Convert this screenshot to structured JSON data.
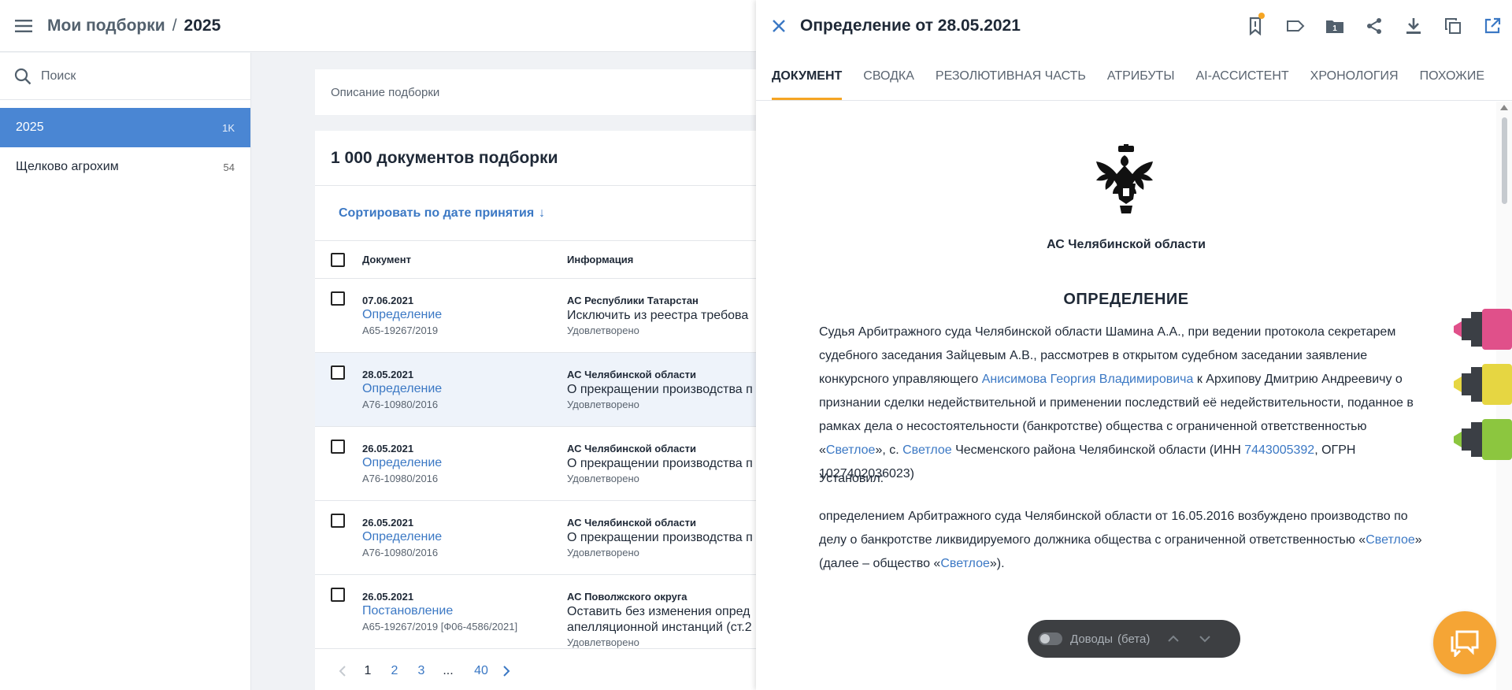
{
  "header": {
    "menu_icon": "hamburger-icon",
    "crumb_root": "Мои подборки",
    "crumb_sep": "/",
    "crumb_current": "2025"
  },
  "sidebar": {
    "search_placeholder": "Поиск",
    "items": [
      {
        "label": "2025",
        "count": "1K",
        "active": true
      },
      {
        "label": "Щелково агрохим",
        "count": "54",
        "active": false
      }
    ]
  },
  "main": {
    "description_placeholder": "Описание подборки",
    "list_title": "1 000 документов подборки",
    "sort_label": "Сортировать по дате принятия",
    "sort_arrow": "↓",
    "col_document": "Документ",
    "col_info": "Информация",
    "rows": [
      {
        "date": "07.06.2021",
        "type": "Определение",
        "num": "А65-19267/2019",
        "court": "АС Республики Татарстан",
        "text": "Исключить из реестра требова",
        "status": "Удовлетворено"
      },
      {
        "date": "28.05.2021",
        "type": "Определение",
        "num": "А76-10980/2016",
        "court": "АС Челябинской области",
        "text": "О прекращении производства п",
        "status": "Удовлетворено"
      },
      {
        "date": "26.05.2021",
        "type": "Определение",
        "num": "А76-10980/2016",
        "court": "АС Челябинской области",
        "text": "О прекращении производства п",
        "status": "Удовлетворено"
      },
      {
        "date": "26.05.2021",
        "type": "Определение",
        "num": "А76-10980/2016",
        "court": "АС Челябинской области",
        "text": "О прекращении производства п",
        "status": "Удовлетворено"
      },
      {
        "date": "26.05.2021",
        "type": "Постановление",
        "num": "А65-19267/2019 [Ф06-4586/2021]",
        "court": "АС Поволжского округа",
        "text": "Оставить без изменения опред",
        "text2": "апелляционной инстанций (ст.2",
        "status": "Удовлетворено"
      }
    ],
    "pager": {
      "pages": [
        "1",
        "2",
        "3"
      ],
      "dots": "...",
      "last": "40",
      "current": "1"
    }
  },
  "panel": {
    "title": "Определение от 28.05.2021",
    "tools": [
      "bookmark-icon",
      "tag-icon",
      "folder-icon",
      "share-icon",
      "download-icon",
      "copy-icon",
      "open-external-icon"
    ],
    "folder_badge": "1",
    "tabs": [
      "Документ",
      "Сводка",
      "Резолютивная часть",
      "Атрибуты",
      "AI-Ассистент",
      "Хронология",
      "Похожие"
    ],
    "active_tab": 0,
    "doc": {
      "court": "АС Челябинской области",
      "title": "ОПРЕДЕЛЕНИЕ",
      "p1_a": "Судья Арбитражного суда Челябинской области Шамина А.А., при ведении протокола секретарем судебного заседания Зайцевым А.В., рассмотрев в открытом судебном заседании заявление конкурсного управляющего ",
      "p1_link1": "Анисимова Георгия Владимировича",
      "p1_b": " к Архипову Дмитрию Андреевичу о признании сделки недействительной и применении последствий её недействительности, поданное в рамках дела о несостоятельности (банкротстве) общества с ограниченной ответственностью «",
      "p1_link2": "Светлое",
      "p1_c": "», с. ",
      "p1_link3": "Светлое",
      "p1_d": " Чесменского района Челябинской области (ИНН ",
      "p1_link4": "7443005392",
      "p1_e": ", ОГРН 1027402036023)",
      "p2": "Установил:",
      "p3_a": "определением Арбитражного суда Челябинской области от 16.05.2016 возбуждено производство по делу о банкротстве ликвидируемого должника общества с ограниченной ответственностью «",
      "p3_link1": "Светлое",
      "p3_b": "» (далее – общество «",
      "p3_link2": "Светлое",
      "p3_c": "»)."
    },
    "highlighters": [
      {
        "name": "pink-highlighter-icon",
        "color": "#e0508a"
      },
      {
        "name": "yellow-highlighter-icon",
        "color": "#e6d642"
      },
      {
        "name": "green-highlighter-icon",
        "color": "#8cc63f"
      }
    ],
    "arguments_toggle": "Доводы",
    "arguments_beta": "(бета)",
    "chat_icon": "chat-icon"
  },
  "colors": {
    "accent": "#f5a524",
    "link": "#3b78c4",
    "active_item": "#4a86d3"
  }
}
